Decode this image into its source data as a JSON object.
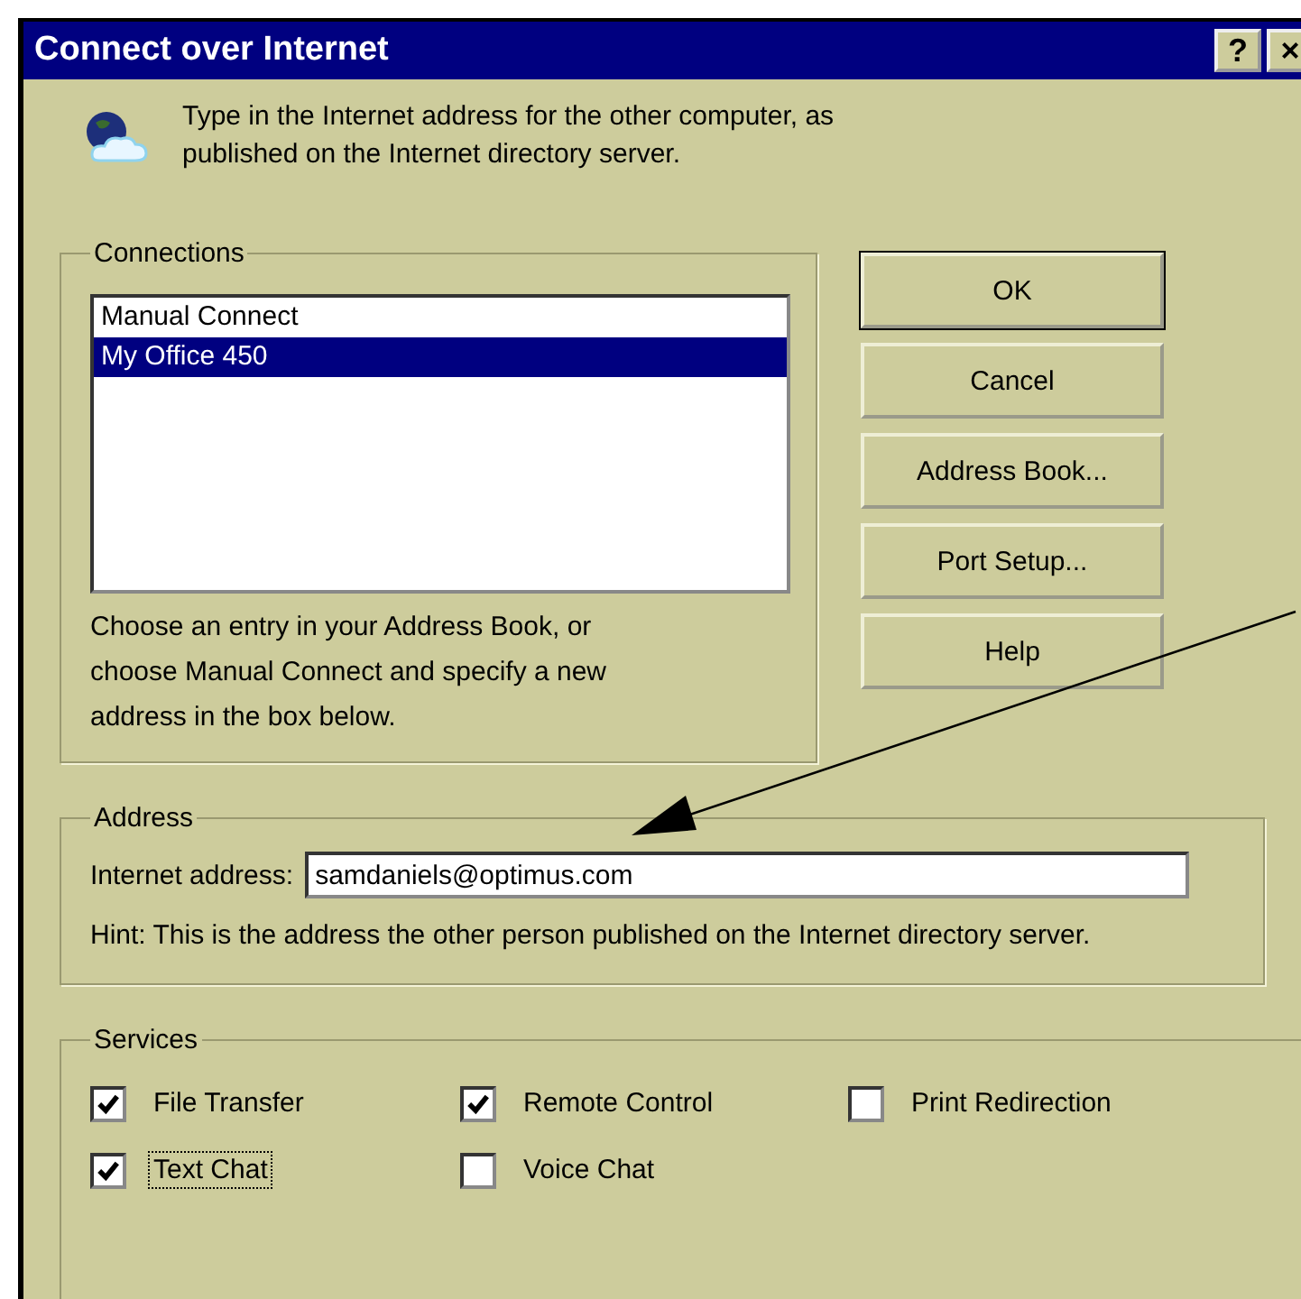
{
  "window": {
    "title": "Connect over Internet",
    "title_buttons": [
      "?",
      "×"
    ]
  },
  "intro": "Type in the Internet address for the other computer, as published on the Internet directory server.",
  "connections": {
    "label": "Connections",
    "items": [
      {
        "label": "Manual Connect",
        "selected": false
      },
      {
        "label": "My Office 450",
        "selected": true
      }
    ],
    "note": "Choose an entry in your Address Book, or choose Manual Connect and specify a new address in the box below."
  },
  "buttons": [
    {
      "label": "OK",
      "default": true
    },
    {
      "label": "Cancel",
      "default": false
    },
    {
      "label": "Address Book...",
      "default": false
    },
    {
      "label": "Port Setup...",
      "default": false
    },
    {
      "label": "Help",
      "default": false
    }
  ],
  "address": {
    "label": "Address",
    "field_label": "Internet address:",
    "value": "samdaniels@optimus.com",
    "hint": "Hint: This is the address the other person published on the Internet directory server."
  },
  "services": {
    "label": "Services",
    "items": [
      {
        "label": "File Transfer",
        "checked": true,
        "focused": false
      },
      {
        "label": "Remote Control",
        "checked": true,
        "focused": false
      },
      {
        "label": "Print Redirection",
        "checked": false,
        "focused": false
      },
      {
        "label": "Text Chat",
        "checked": true,
        "focused": true
      },
      {
        "label": "Voice Chat",
        "checked": false,
        "focused": false
      }
    ]
  }
}
